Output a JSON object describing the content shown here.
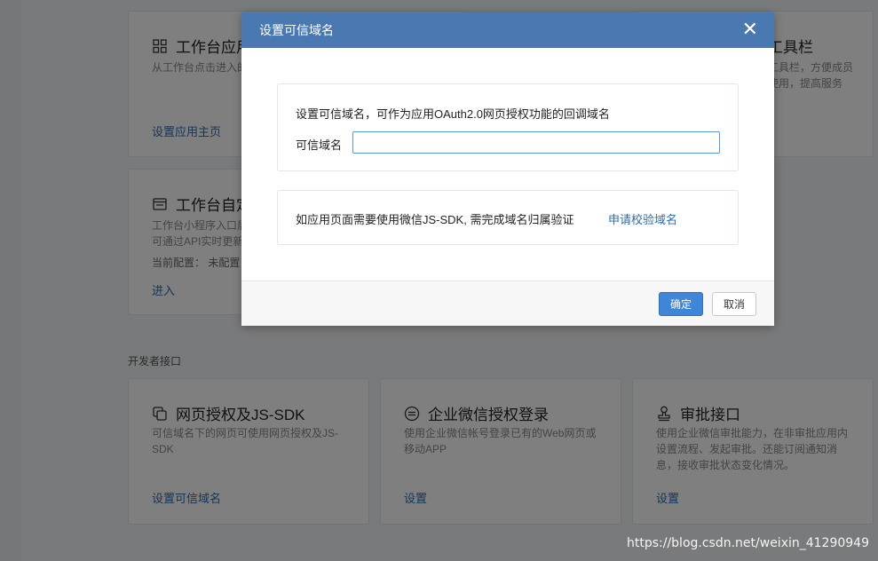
{
  "background": {
    "cards": {
      "workbench_app": {
        "title": "工作台应用主页",
        "desc": "从工作台点击进入的网页",
        "link": "设置应用主页"
      },
      "toolbar": {
        "title": "工具栏",
        "desc_line1": "工具栏，方便成员",
        "desc_line2": "使用，提高服务"
      },
      "workbench_custom": {
        "title": "工作台自定义展示",
        "desc_line1": "工作台小程序入口展示",
        "desc_line2": "可通过API实时更新",
        "current_config": "当前配置： 未配置",
        "link": "进入"
      }
    },
    "section_label": "开发者接口",
    "dev_cards": [
      {
        "title": "网页授权及JS-SDK",
        "desc": "可信域名下的网页可使用网页授权及JS-SDK",
        "link": "设置可信域名",
        "icon": "copy-icon"
      },
      {
        "title": "企业微信授权登录",
        "desc": "使用企业微信帐号登录已有的Web网页或移动APP",
        "link": "设置",
        "icon": "login-icon"
      },
      {
        "title": "审批接口",
        "desc": "使用企业微信审批能力，在非审批应用内设置流程、发起审批。还能订阅通知消息，接收审批状态变化情况。",
        "link": "设置",
        "icon": "stamp-icon"
      }
    ]
  },
  "modal": {
    "title": "设置可信域名",
    "close": "✕",
    "hint": "设置可信域名，可作为应用OAuth2.0网页授权功能的回调域名",
    "field_label": "可信域名",
    "field_value": "",
    "field_placeholder": "",
    "verify_text": "如应用页面需要使用微信JS-SDK, 需完成域名归属验证",
    "verify_link": "申请校验域名",
    "ok": "确定",
    "cancel": "取消"
  },
  "watermark": "https://blog.csdn.net/weixin_41290949",
  "colors": {
    "header": "#4a78b0",
    "primary": "#3f86d8",
    "link": "#2b6cb0"
  }
}
